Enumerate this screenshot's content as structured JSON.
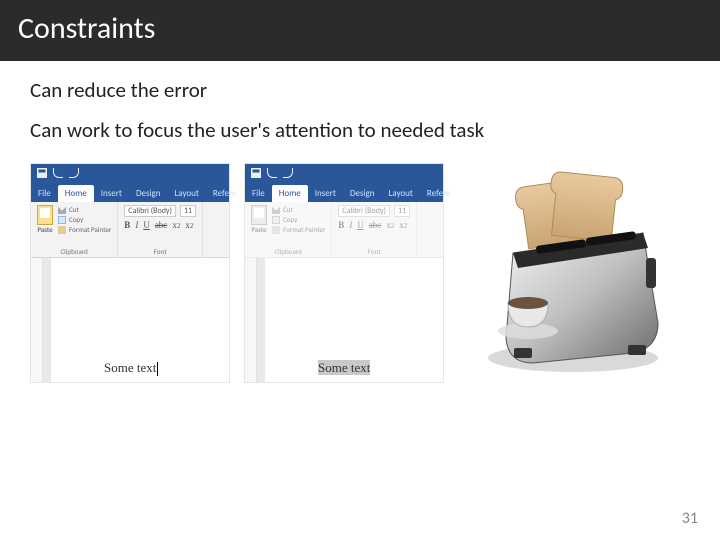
{
  "title": "Constraints",
  "bullets": [
    "Can reduce the error",
    "Can work to focus the user's attention to needed task"
  ],
  "word": {
    "tabs": [
      "File",
      "Home",
      "Insert",
      "Design",
      "Layout",
      "Refere"
    ],
    "active_tab": "Home",
    "clipboard": {
      "paste": "Paste",
      "cut": "Cut",
      "copy": "Copy",
      "format_painter": "Format Painter",
      "group_label": "Clipboard"
    },
    "font": {
      "name": "Calibri (Body)",
      "size": "11",
      "group_label": "Font"
    },
    "sample_text": "Some text"
  },
  "page_number": "31"
}
